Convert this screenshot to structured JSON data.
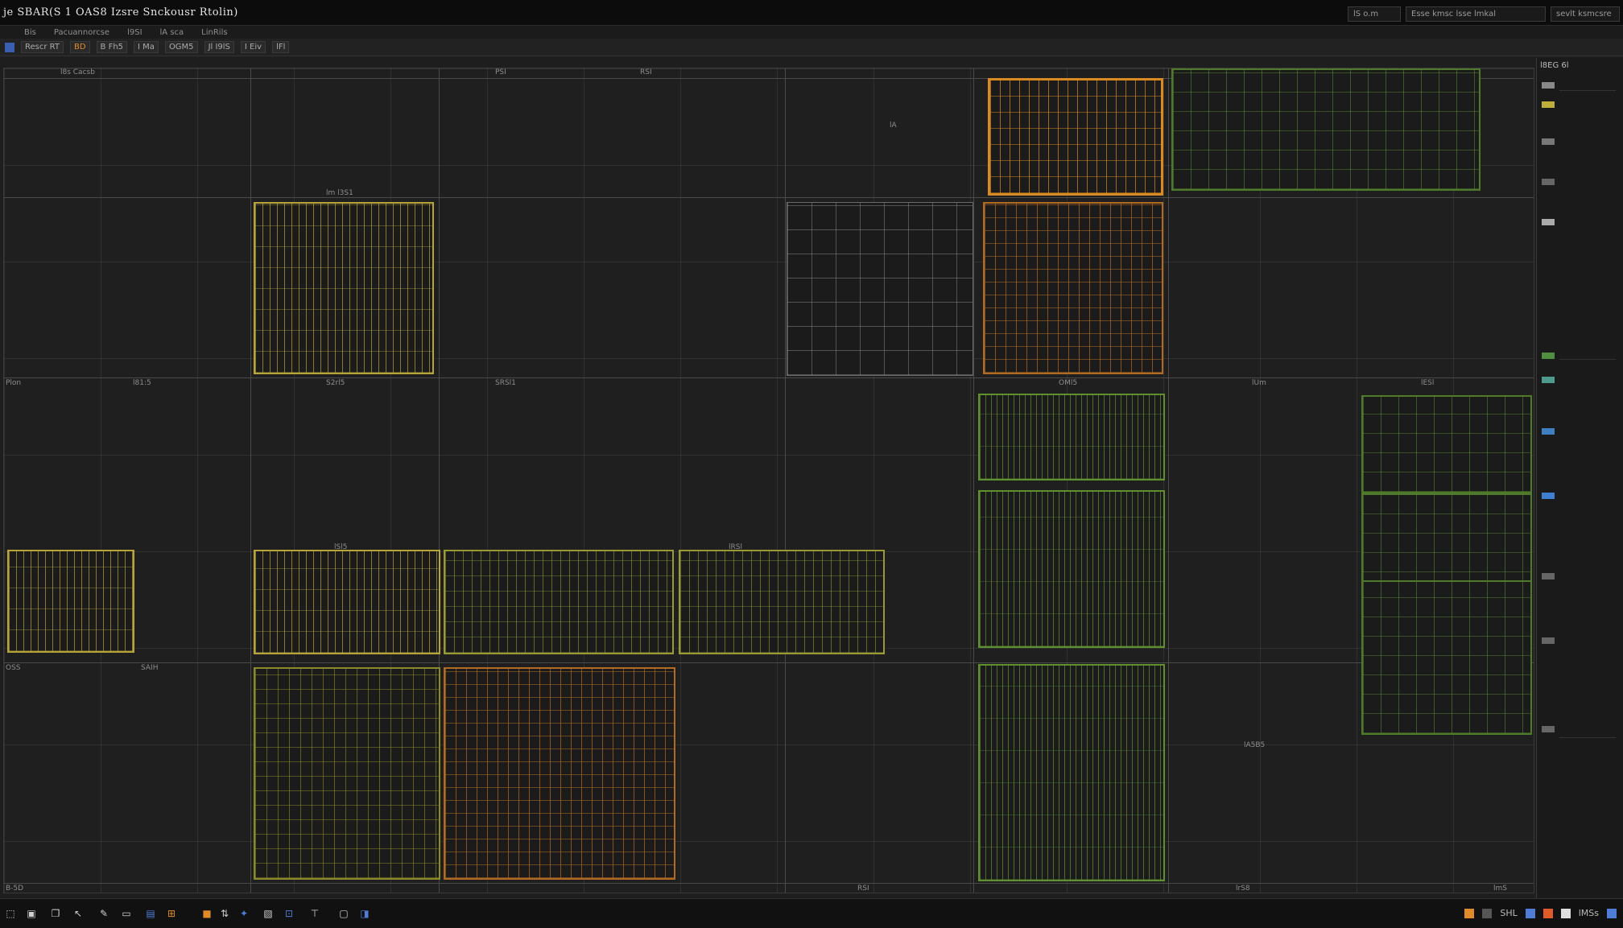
{
  "window": {
    "title": "je SBAR(S 1 OAS8 Izsre Snckousr Rtolin)"
  },
  "title_right": {
    "field1": "lS  o.m",
    "field2": "Esse kmsc lsse lmkal",
    "field3": "sevlt ksmcsre"
  },
  "toolbar1": {
    "items": [
      "Bis",
      "Pacuannorcse",
      "l9SI",
      "lA sca",
      "LinRils"
    ]
  },
  "toolbar2": {
    "items": [
      "Rescr RT",
      "BD",
      "B Fh5",
      "I  Ma",
      "OGM5",
      "Jl I9lS",
      "I  Eiv",
      "lFl"
    ]
  },
  "grid": {
    "row_labels": [
      "Plon",
      "l81:5",
      "OSS",
      "lA",
      "B-5D"
    ],
    "labels": {
      "l1": "l8s  Cacsb",
      "l2": "PSI",
      "l3": "RSI",
      "l4": "lm  l3S1",
      "l5": "S2rl5",
      "l6": "SRSl1",
      "l7": "OMl5",
      "l8": "lUm",
      "l9": "lESl",
      "l10": "lSl5",
      "l11": "lRSl",
      "l12": "lA5B5",
      "l13": "SAIH",
      "l14": "RSI",
      "l15": "lrS8",
      "l16": "lmS"
    }
  },
  "right_panel": {
    "title": "l8EG  6l"
  },
  "bottom": {
    "right_text1": "SHL",
    "right_text2": "lMSs"
  },
  "colors": {
    "yellow": "#b8a53a",
    "orange": "#d98a22",
    "brown": "#b06a22",
    "green": "#4f7a2a",
    "lime": "#5f8f2f"
  }
}
